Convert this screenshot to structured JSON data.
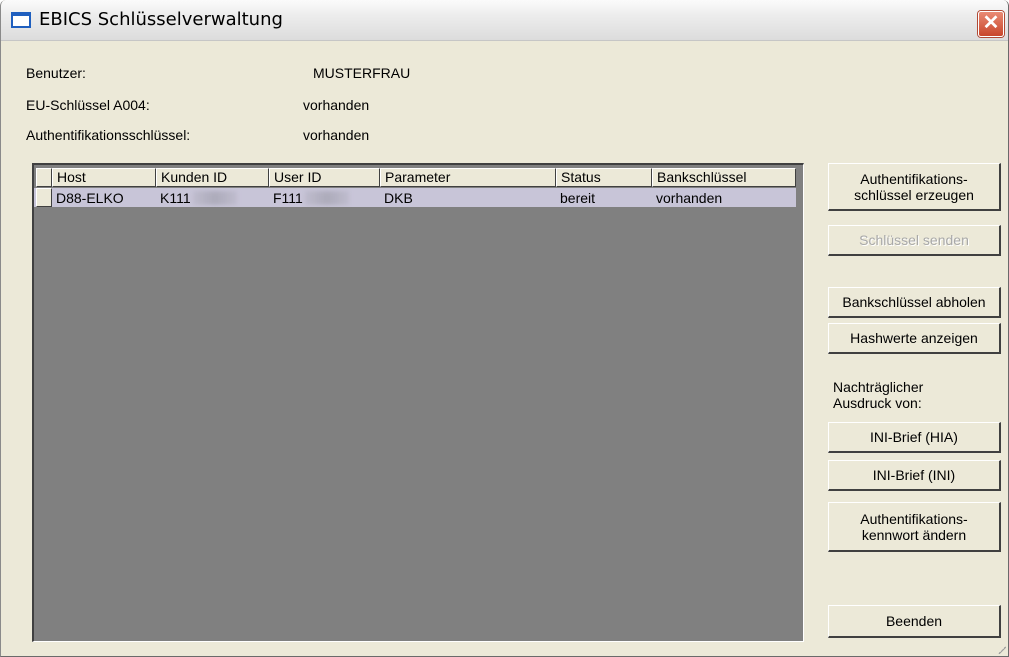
{
  "window": {
    "title": "EBICS Schlüsselverwaltung",
    "close_glyph": "✕"
  },
  "info": {
    "benutzer_label": "Benutzer:",
    "benutzer_value": "MUSTERFRAU",
    "eu_label": "EU-Schlüssel A004:",
    "eu_value": "vorhanden",
    "auth_label": "Authentifikationsschlüssel:",
    "auth_value": "vorhanden"
  },
  "table": {
    "columns": [
      "Host",
      "Kunden ID",
      "User ID",
      "Parameter",
      "Status",
      "Bankschlüssel"
    ],
    "rows": [
      {
        "host": "D88-ELKO",
        "kunden_id": "K111",
        "user_id": "F111",
        "parameter": "DKB",
        "status": "bereit",
        "bankschluessel": "vorhanden"
      }
    ]
  },
  "buttons": {
    "auth_create_line1": "Authentifikations-",
    "auth_create_line2": "schlüssel erzeugen",
    "send_keys": "Schlüssel senden",
    "fetch_bank_keys": "Bankschlüssel abholen",
    "show_hashes": "Hashwerte anzeigen",
    "print_label_line1": "Nachträglicher",
    "print_label_line2": "Ausdruck von:",
    "ini_hia": "INI-Brief (HIA)",
    "ini_ini": "INI-Brief (INI)",
    "change_pw_line1": "Authentifikations-",
    "change_pw_line2": "kennwort ändern",
    "quit": "Beenden"
  },
  "colors": {
    "list_background": "#808080",
    "selected_row": "#c8c5d8",
    "dialog_face": "#ece9d8",
    "close_button": "#c8462b"
  }
}
